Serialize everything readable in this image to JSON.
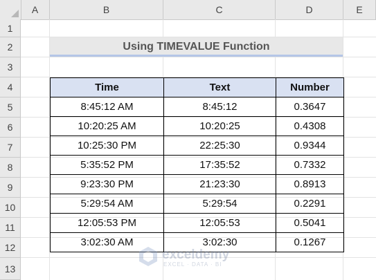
{
  "columns": [
    "A",
    "B",
    "C",
    "D",
    "E"
  ],
  "rows": [
    "1",
    "2",
    "3",
    "4",
    "5",
    "6",
    "7",
    "8",
    "9",
    "10",
    "11",
    "12",
    "13"
  ],
  "title": "Using TIMEVALUE Function",
  "table": {
    "headers": [
      "Time",
      "Text",
      "Number"
    ],
    "rows": [
      [
        "8:45:12 AM",
        "8:45:12",
        "0.3647"
      ],
      [
        "10:20:25 AM",
        "10:20:25",
        "0.4308"
      ],
      [
        "10:25:30 PM",
        "22:25:30",
        "0.9344"
      ],
      [
        "5:35:52 PM",
        "17:35:52",
        "0.7332"
      ],
      [
        "9:23:30 PM",
        "21:23:30",
        "0.8913"
      ],
      [
        "5:29:54 AM",
        "5:29:54",
        "0.2291"
      ],
      [
        "12:05:53 PM",
        "12:05:53",
        "0.5041"
      ],
      [
        "3:02:30 AM",
        "3:02:30",
        "0.1267"
      ]
    ]
  },
  "watermark": {
    "name": "exceldemy",
    "tagline": "EXCEL · DATA · BI"
  },
  "colors": {
    "header_fill": "#d9e1f2",
    "title_fill": "#e8e8e8",
    "title_underline": "#b4c6e7"
  }
}
